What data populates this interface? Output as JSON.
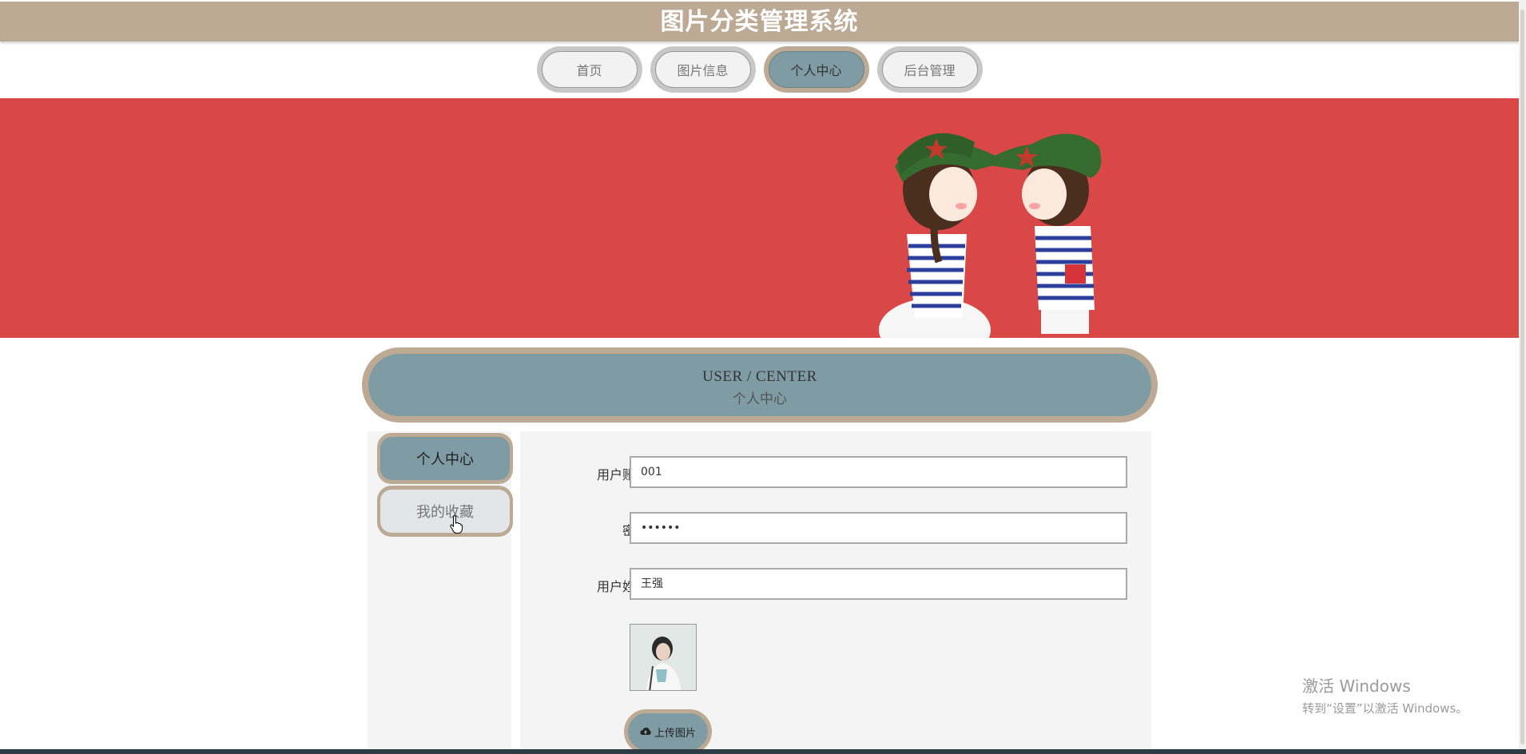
{
  "header": {
    "title": "图片分类管理系统"
  },
  "nav": {
    "items": [
      {
        "label": "首页"
      },
      {
        "label": "图片信息"
      },
      {
        "label": "个人中心"
      },
      {
        "label": "后台管理"
      }
    ],
    "active_index": 2
  },
  "section": {
    "en_title": "USER / CENTER",
    "cn_title": "个人中心"
  },
  "sidebar": {
    "items": [
      {
        "label": "个人中心"
      },
      {
        "label": "我的收藏"
      }
    ],
    "active_index": 0
  },
  "form": {
    "account": {
      "label": "用户账号",
      "value": "001"
    },
    "password": {
      "label": "密码",
      "value": "••••••"
    },
    "name": {
      "label": "用户姓名",
      "value": "王强"
    },
    "upload_label": "上传图片"
  },
  "watermark": {
    "line1": "激活 Windows",
    "line2": "转到“设置”以激活 Windows。"
  },
  "colors": {
    "header_bg": "#bcaa94",
    "accent": "#7f9ba3",
    "banner_bg": "#da4747"
  }
}
